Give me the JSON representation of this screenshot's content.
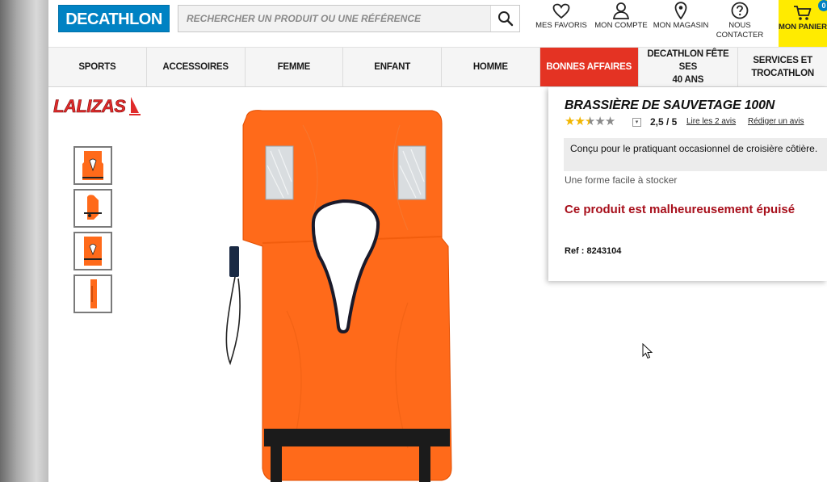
{
  "header": {
    "logo": "DECATHLON",
    "search_placeholder": "RECHERCHER UN PRODUIT OU UNE RÉFÉRENCE",
    "favorites": "MES FAVORIS",
    "account": "MON COMPTE",
    "store": "MON MAGASIN",
    "contact_line1": "NOUS",
    "contact_line2": "CONTACTER",
    "cart_label": "MON PANIER",
    "cart_count": "0"
  },
  "nav": {
    "items": [
      {
        "label": "SPORTS"
      },
      {
        "label": "ACCESSOIRES"
      },
      {
        "label": "FEMME"
      },
      {
        "label": "ENFANT"
      },
      {
        "label": "HOMME"
      },
      {
        "label": "BONNES AFFAIRES"
      },
      {
        "label_line1": "DECATHLON FÊTE SES",
        "label_line2": "40 ANS"
      },
      {
        "label_line1": "SERVICES ET",
        "label_line2": "TROCATHLON"
      }
    ]
  },
  "gallery": {
    "brand": "LALIZAS",
    "thumbnail_count": 4
  },
  "product": {
    "title": "BRASSIÈRE DE SAUVETAGE 100N",
    "rating": "2,5 / 5",
    "rating_value": 2.5,
    "rating_max": 5,
    "read_reviews": "Lire les 2 avis",
    "write_review": "Rédiger un avis",
    "description": "Conçu pour le pratiquant occasionnel de croisière côtière.",
    "feature": "Une forme facile à stocker",
    "availability": "Ce produit est malheureusement épuisé",
    "ref": "Ref : 8243104"
  },
  "colors": {
    "brand_blue": "#0082c3",
    "cart_yellow": "#ffeb00",
    "sale_red": "#e43323",
    "soldout_red": "#a8101c",
    "vest_orange": "#ff6a1a"
  },
  "icons": [
    "search-icon",
    "heart-icon",
    "user-icon",
    "location-pin-icon",
    "question-icon",
    "cart-icon",
    "chevron-down-icon",
    "star-icon",
    "mouse-cursor-icon"
  ]
}
